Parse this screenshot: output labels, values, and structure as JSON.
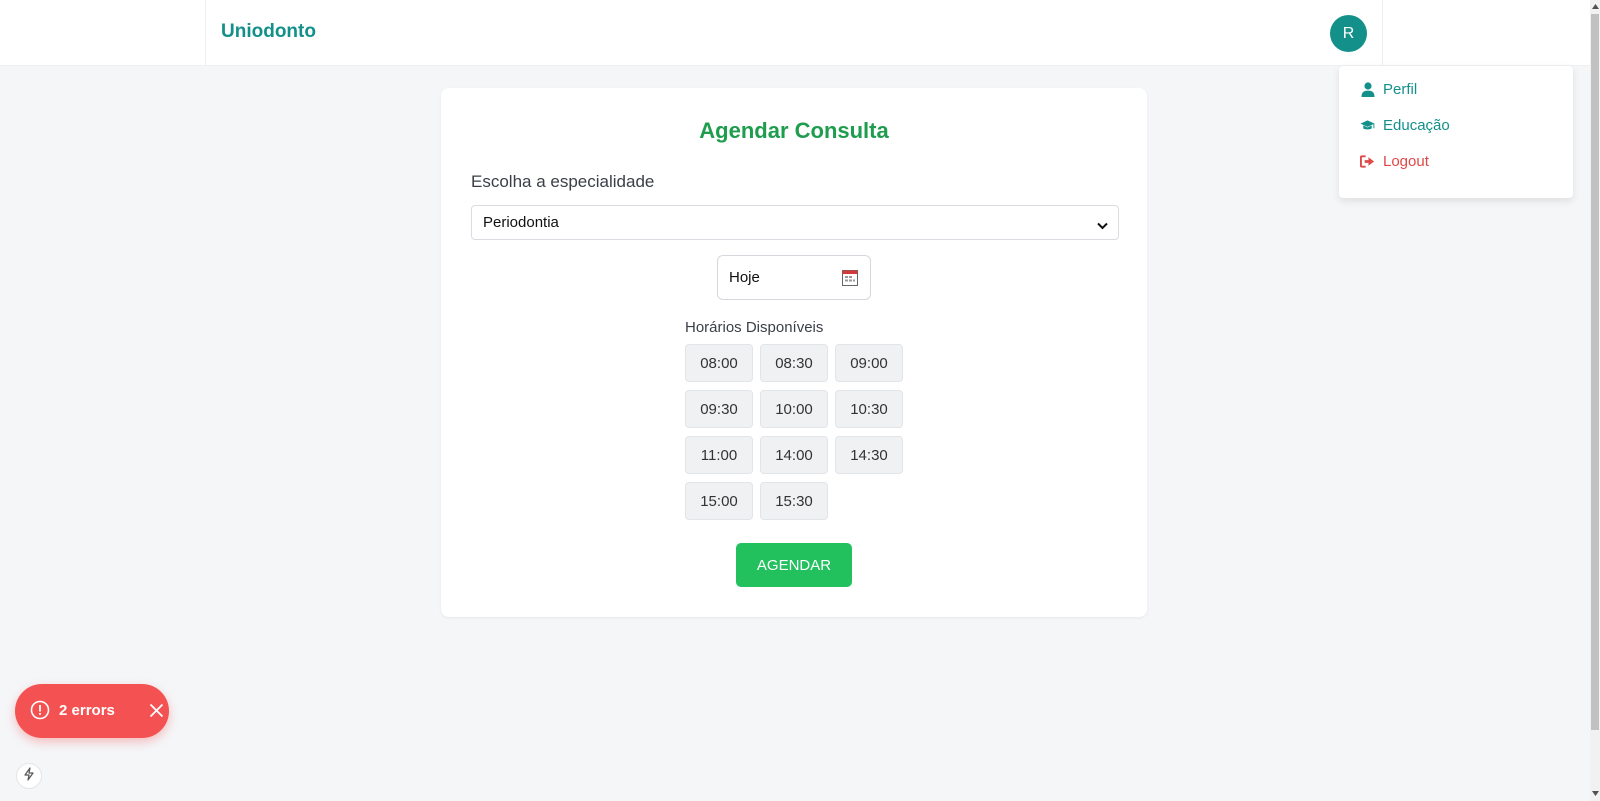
{
  "header": {
    "brand": "Uniodonto",
    "avatar_initial": "R"
  },
  "user_menu": {
    "items": [
      {
        "label": "Perfil",
        "icon": "user-icon"
      },
      {
        "label": "Educação",
        "icon": "graduation-cap-icon"
      },
      {
        "label": "Logout",
        "icon": "sign-out-icon"
      }
    ]
  },
  "form": {
    "title": "Agendar Consulta",
    "specialty_label": "Escolha a especialidade",
    "specialty_value": "Periodontia",
    "date_value": "Hoje",
    "slots_label": "Horários Disponíveis",
    "slots": [
      "08:00",
      "08:30",
      "09:00",
      "09:30",
      "10:00",
      "10:30",
      "11:00",
      "14:00",
      "14:30",
      "15:00",
      "15:30"
    ],
    "submit_label": "AGENDAR"
  },
  "errors": {
    "label": "2 errors"
  },
  "colors": {
    "brand": "#14908a",
    "title": "#1f9d4e",
    "button": "#22c15e",
    "error": "#f45252",
    "logout": "#e04848"
  }
}
